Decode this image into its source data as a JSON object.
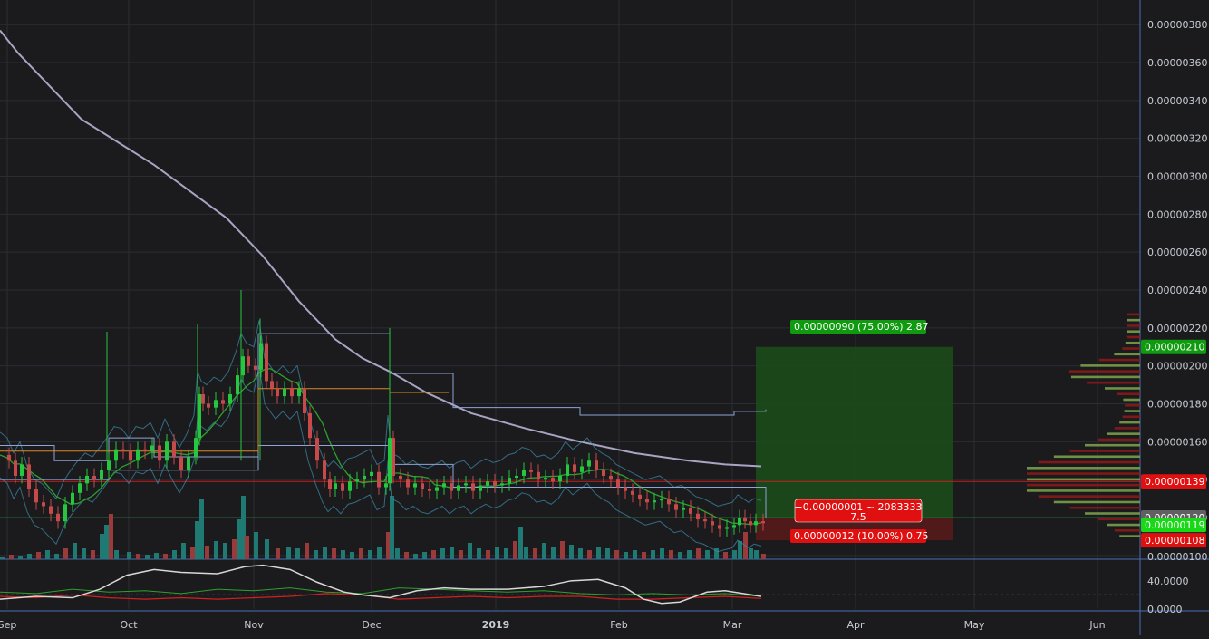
{
  "chart_data": {
    "type": "candlestick",
    "x_ticks": [
      "Sep",
      "Oct",
      "Nov",
      "Dec",
      "2019",
      "Feb",
      "Mar",
      "Apr",
      "May",
      "Jun"
    ],
    "price_ticks": [
      "0.00000380",
      "0.00000360",
      "0.00000340",
      "0.00000320",
      "0.00000300",
      "0.00000280",
      "0.00000260",
      "0.00000240",
      "0.00000220",
      "0.00000200",
      "0.00000180",
      "0.00000160",
      "0.00000140",
      "0.00000120",
      "0.00000100"
    ],
    "price_tick_values": [
      380,
      360,
      340,
      320,
      300,
      280,
      260,
      240,
      220,
      200,
      180,
      160,
      140,
      120,
      100
    ],
    "price_unit_scale": 1e-08,
    "price_ylim": [
      98,
      393
    ],
    "oscillator_ticks": [
      "40.0000",
      "0.0000"
    ],
    "oscillator_tick_values": [
      40,
      0
    ],
    "oscillator_ylim": [
      0,
      68
    ],
    "oscillator_dashed_level": 20,
    "moving_average_200": [
      [
        0,
        377
      ],
      [
        20,
        365
      ],
      [
        50,
        350
      ],
      [
        90,
        330
      ],
      [
        130,
        318
      ],
      [
        170,
        306
      ],
      [
        210,
        292
      ],
      [
        250,
        278
      ],
      [
        290,
        258
      ],
      [
        330,
        234
      ],
      [
        370,
        214
      ],
      [
        400,
        204
      ],
      [
        430,
        197
      ],
      [
        470,
        186
      ],
      [
        520,
        175
      ],
      [
        580,
        167
      ],
      [
        640,
        160
      ],
      [
        700,
        154
      ],
      [
        760,
        150
      ],
      [
        800,
        148
      ],
      [
        840,
        147
      ]
    ],
    "price_closes": [
      [
        0,
        153
      ],
      [
        8,
        150
      ],
      [
        15,
        142
      ],
      [
        22,
        148
      ],
      [
        30,
        135
      ],
      [
        38,
        128
      ],
      [
        46,
        126
      ],
      [
        54,
        122
      ],
      [
        62,
        118
      ],
      [
        70,
        127
      ],
      [
        78,
        133
      ],
      [
        86,
        138
      ],
      [
        94,
        142
      ],
      [
        102,
        140
      ],
      [
        110,
        145
      ],
      [
        118,
        150
      ],
      [
        126,
        156
      ],
      [
        134,
        155
      ],
      [
        142,
        150
      ],
      [
        150,
        156
      ],
      [
        158,
        155
      ],
      [
        166,
        158
      ],
      [
        174,
        150
      ],
      [
        182,
        160
      ],
      [
        190,
        152
      ],
      [
        198,
        145
      ],
      [
        206,
        152
      ],
      [
        214,
        162
      ],
      [
        218,
        185
      ],
      [
        222,
        180
      ],
      [
        228,
        178
      ],
      [
        236,
        182
      ],
      [
        244,
        180
      ],
      [
        252,
        185
      ],
      [
        260,
        195
      ],
      [
        266,
        205
      ],
      [
        272,
        200
      ],
      [
        280,
        198
      ],
      [
        286,
        212
      ],
      [
        292,
        192
      ],
      [
        298,
        188
      ],
      [
        304,
        184
      ],
      [
        312,
        188
      ],
      [
        320,
        184
      ],
      [
        328,
        188
      ],
      [
        334,
        175
      ],
      [
        340,
        162
      ],
      [
        348,
        150
      ],
      [
        356,
        140
      ],
      [
        362,
        135
      ],
      [
        368,
        138
      ],
      [
        376,
        134
      ],
      [
        384,
        139
      ],
      [
        392,
        140
      ],
      [
        400,
        142
      ],
      [
        408,
        144
      ],
      [
        416,
        136
      ],
      [
        424,
        138
      ],
      [
        428,
        162
      ],
      [
        432,
        142
      ],
      [
        440,
        140
      ],
      [
        448,
        136
      ],
      [
        456,
        138
      ],
      [
        464,
        135
      ],
      [
        472,
        134
      ],
      [
        480,
        136
      ],
      [
        488,
        138
      ],
      [
        496,
        134
      ],
      [
        504,
        137
      ],
      [
        512,
        138
      ],
      [
        520,
        134
      ],
      [
        528,
        137
      ],
      [
        536,
        139
      ],
      [
        544,
        137
      ],
      [
        552,
        138
      ],
      [
        560,
        141
      ],
      [
        568,
        142
      ],
      [
        576,
        145
      ],
      [
        584,
        144
      ],
      [
        592,
        140
      ],
      [
        600,
        141
      ],
      [
        608,
        139
      ],
      [
        616,
        142
      ],
      [
        624,
        148
      ],
      [
        632,
        144
      ],
      [
        640,
        147
      ],
      [
        648,
        150
      ],
      [
        656,
        145
      ],
      [
        664,
        142
      ],
      [
        672,
        140
      ],
      [
        680,
        136
      ],
      [
        688,
        134
      ],
      [
        696,
        132
      ],
      [
        704,
        130
      ],
      [
        712,
        128
      ],
      [
        720,
        129
      ],
      [
        728,
        130
      ],
      [
        736,
        127
      ],
      [
        744,
        124
      ],
      [
        752,
        125
      ],
      [
        760,
        122
      ],
      [
        768,
        119
      ],
      [
        776,
        118
      ],
      [
        784,
        116
      ],
      [
        792,
        114
      ],
      [
        800,
        115
      ],
      [
        808,
        116
      ],
      [
        814,
        120
      ],
      [
        820,
        118
      ],
      [
        826,
        116
      ],
      [
        832,
        118
      ],
      [
        840,
        117
      ]
    ],
    "volume_bars": [
      [
        0,
        3
      ],
      [
        10,
        5
      ],
      [
        20,
        4
      ],
      [
        30,
        6
      ],
      [
        40,
        8
      ],
      [
        50,
        10
      ],
      [
        60,
        6
      ],
      [
        70,
        12
      ],
      [
        80,
        18
      ],
      [
        90,
        12
      ],
      [
        100,
        10
      ],
      [
        110,
        28
      ],
      [
        115,
        38
      ],
      [
        120,
        50
      ],
      [
        126,
        10
      ],
      [
        140,
        8
      ],
      [
        150,
        6
      ],
      [
        160,
        5
      ],
      [
        170,
        7
      ],
      [
        180,
        6
      ],
      [
        190,
        10
      ],
      [
        200,
        18
      ],
      [
        210,
        14
      ],
      [
        215,
        42
      ],
      [
        220,
        66
      ],
      [
        226,
        15
      ],
      [
        236,
        20
      ],
      [
        246,
        18
      ],
      [
        256,
        22
      ],
      [
        262,
        44
      ],
      [
        266,
        70
      ],
      [
        270,
        26
      ],
      [
        280,
        30
      ],
      [
        292,
        22
      ],
      [
        304,
        12
      ],
      [
        316,
        14
      ],
      [
        326,
        12
      ],
      [
        336,
        18
      ],
      [
        346,
        10
      ],
      [
        356,
        14
      ],
      [
        366,
        12
      ],
      [
        376,
        10
      ],
      [
        386,
        8
      ],
      [
        396,
        12
      ],
      [
        406,
        10
      ],
      [
        416,
        14
      ],
      [
        426,
        30
      ],
      [
        430,
        70
      ],
      [
        436,
        12
      ],
      [
        446,
        8
      ],
      [
        456,
        6
      ],
      [
        466,
        8
      ],
      [
        476,
        10
      ],
      [
        486,
        12
      ],
      [
        496,
        14
      ],
      [
        506,
        10
      ],
      [
        516,
        18
      ],
      [
        526,
        12
      ],
      [
        536,
        10
      ],
      [
        546,
        14
      ],
      [
        556,
        12
      ],
      [
        566,
        20
      ],
      [
        572,
        36
      ],
      [
        578,
        14
      ],
      [
        588,
        12
      ],
      [
        598,
        18
      ],
      [
        608,
        14
      ],
      [
        618,
        20
      ],
      [
        628,
        16
      ],
      [
        638,
        12
      ],
      [
        648,
        10
      ],
      [
        658,
        14
      ],
      [
        668,
        12
      ],
      [
        678,
        10
      ],
      [
        688,
        8
      ],
      [
        698,
        10
      ],
      [
        708,
        8
      ],
      [
        718,
        10
      ],
      [
        728,
        12
      ],
      [
        738,
        10
      ],
      [
        748,
        8
      ],
      [
        758,
        10
      ],
      [
        768,
        12
      ],
      [
        778,
        10
      ],
      [
        788,
        12
      ],
      [
        798,
        8
      ],
      [
        808,
        10
      ],
      [
        814,
        20
      ],
      [
        820,
        30
      ],
      [
        826,
        12
      ],
      [
        832,
        10
      ],
      [
        840,
        6
      ]
    ],
    "volume_max": 70,
    "oscillator_white": [
      [
        0,
        14
      ],
      [
        40,
        18
      ],
      [
        80,
        16
      ],
      [
        110,
        28
      ],
      [
        140,
        48
      ],
      [
        170,
        56
      ],
      [
        200,
        52
      ],
      [
        240,
        50
      ],
      [
        270,
        60
      ],
      [
        290,
        62
      ],
      [
        320,
        56
      ],
      [
        350,
        38
      ],
      [
        380,
        24
      ],
      [
        400,
        20
      ],
      [
        430,
        16
      ],
      [
        460,
        26
      ],
      [
        490,
        30
      ],
      [
        520,
        28
      ],
      [
        560,
        28
      ],
      [
        600,
        32
      ],
      [
        630,
        40
      ],
      [
        660,
        42
      ],
      [
        690,
        30
      ],
      [
        710,
        14
      ],
      [
        730,
        8
      ],
      [
        750,
        10
      ],
      [
        780,
        24
      ],
      [
        800,
        26
      ],
      [
        820,
        22
      ],
      [
        840,
        18
      ]
    ],
    "oscillator_red": [
      [
        0,
        18
      ],
      [
        40,
        16
      ],
      [
        80,
        20
      ],
      [
        120,
        16
      ],
      [
        160,
        14
      ],
      [
        200,
        16
      ],
      [
        240,
        14
      ],
      [
        280,
        16
      ],
      [
        320,
        18
      ],
      [
        360,
        22
      ],
      [
        400,
        20
      ],
      [
        440,
        14
      ],
      [
        480,
        16
      ],
      [
        520,
        18
      ],
      [
        560,
        16
      ],
      [
        600,
        18
      ],
      [
        640,
        18
      ],
      [
        680,
        14
      ],
      [
        720,
        14
      ],
      [
        760,
        16
      ],
      [
        800,
        18
      ],
      [
        840,
        15
      ]
    ],
    "oscillator_green": [
      [
        0,
        24
      ],
      [
        40,
        22
      ],
      [
        80,
        28
      ],
      [
        120,
        24
      ],
      [
        160,
        26
      ],
      [
        200,
        22
      ],
      [
        240,
        28
      ],
      [
        280,
        26
      ],
      [
        320,
        30
      ],
      [
        360,
        24
      ],
      [
        400,
        22
      ],
      [
        440,
        30
      ],
      [
        480,
        28
      ],
      [
        520,
        26
      ],
      [
        560,
        24
      ],
      [
        600,
        26
      ],
      [
        640,
        22
      ],
      [
        680,
        20
      ],
      [
        720,
        22
      ],
      [
        760,
        20
      ],
      [
        800,
        22
      ],
      [
        840,
        18
      ]
    ],
    "current_price_values": {
      "take_profit": 210,
      "entry": 120,
      "stop": 108,
      "ask": 119,
      "red_line": 139
    },
    "labels": {
      "take_profit": "0.00000090 (75.00%) 2.87",
      "stop_loss": "0.00000012 (10.00%) 0.75",
      "position_line1": "−0.00000001 ~ 2083333",
      "position_line2": "7.5",
      "price_tp": "0.00000210",
      "price_red": "0.00000139",
      "price_current": "0.00000120",
      "price_green": "0.00000119",
      "price_stop": "0.00000108"
    }
  },
  "colors": {
    "background": "#1b1b1d",
    "grid": "#2a2d34",
    "axis": "#4a6fb5",
    "up": "#26c640",
    "down": "#c74a4a",
    "ma200": "#a8a4c4",
    "bollinger": "#3d8fb0",
    "channel_blue": "#8ea3d8",
    "channel_orange": "#d88a2a",
    "ema_green": "#2ea02e",
    "tp_zone": "#1a4d1a",
    "sl_zone": "#5a1a1a",
    "label_green": "#109a10",
    "label_red": "#e01010",
    "vol_green": "#1f7a73",
    "vol_red": "#9a3a3a"
  }
}
